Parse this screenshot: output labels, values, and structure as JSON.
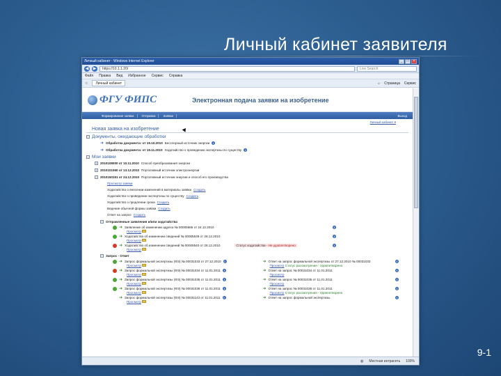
{
  "slide": {
    "title": "Личный кабинет заявителя",
    "page_number": "9-1"
  },
  "browser": {
    "window_title": "Личный кабинет - Windows Internet Explorer",
    "url": "https://10.1.1.20/",
    "search_placeholder": "Live Search",
    "menu": [
      "Файл",
      "Правка",
      "Вид",
      "Избранное",
      "Сервис",
      "Справка"
    ],
    "tab_label": "Личный кабинет",
    "toolbar_items": [
      "Страница",
      "Сервис"
    ],
    "status_text": "Местная интрасеть",
    "zoom": "100%"
  },
  "site": {
    "logo_text": "ФГУ ФИПС",
    "heading": "Электронная подача заявки на изобретение",
    "nav_tabs": [
      "Формирование заявки",
      "Отправка",
      "Заявки"
    ],
    "nav_right": "Выход",
    "user_select": "Личный кабинет"
  },
  "page": {
    "new_app_title": "Новая заявка на изобретение",
    "docs_section": "Документы, ожидающие обработки",
    "docs": [
      {
        "date": "Обработка документа: от 19.10.2010",
        "text": "Бесспорный источник энергии"
      },
      {
        "date": "Обработка документа: от 19.11.2010",
        "text": "Ходатайство о проведении экспертизы по существу"
      }
    ],
    "my_apps_section": "Мои заявки",
    "apps": [
      {
        "num": "2010108000 от 10.11.2010",
        "text": "Способ преобразования энергии"
      },
      {
        "num": "2010101060 от 13.12.2010",
        "text": "Портативный источник электроэнергии"
      },
      {
        "num": "2010150161 от 24.12.2010",
        "text": "Портативный источник энергии и способ его производства"
      }
    ],
    "app_actions": [
      {
        "text": "Просмотр заявки",
        "link": ""
      },
      {
        "text": "Ходатайство о внесении изменений в материалы заявки",
        "link": "Создать"
      },
      {
        "text": "Ходатайство о проведении экспертизы по существу",
        "link": "Создать"
      },
      {
        "text": "Ходатайство о продлении срока",
        "link": "Создать"
      },
      {
        "text": "Ведение обычной формы заявки",
        "link": "Создать"
      },
      {
        "text": "Ответ на запрос",
        "link": "Создать"
      }
    ],
    "sent_section": "Отправленные заявления и/или ходатайства",
    "sent": [
      {
        "status": "ok",
        "text": "Заявление об изменении адреса № 00005665 от 24.12.2010",
        "link": "Просмотр",
        "right": ""
      },
      {
        "status": "ok",
        "text": "Ходатайство об изменении сведений № 00005539 от 28.12.2010",
        "link": "Просмотр",
        "right": ""
      },
      {
        "status": "fail",
        "text": "Ходатайство об изменении сведений № 00005540 от 28.12.2010",
        "link": "Просмотр",
        "right_prefix": "Статус ходатайства -",
        "right": "Не удовлетворено"
      }
    ],
    "req_section": "Запрос - Ответ",
    "requests": [
      {
        "status": "ok",
        "left": "Запрос формальной экспертизы (ФЭ) № 00031033 от 27.12.2010",
        "left_link": "Просмотр",
        "right": "Ответ на запрос формальной экспертизы от 27.12.2010 № 00031033",
        "right_link": "Просмотр",
        "right_status": "Статус рассмотрения - Удовлетворено"
      },
      {
        "status": "fail",
        "left": "Запрос формальной экспертизы (ФЭ) № 00031034 от 11.01.2011",
        "left_link": "Просмотр",
        "right": "Ответ на запрос № 00031034 от 11.01.2011",
        "right_link": "Просмотр",
        "right_status": ""
      },
      {
        "status": "ok",
        "left": "Запрос формальной экспертизы (ФЭ) № 00031035 от 11.01.2011",
        "left_link": "Просмотр",
        "right": "Ответ на запрос № 00031035 от 11.01.2011",
        "right_link": "Просмотр",
        "right_status": ""
      },
      {
        "status": "ok",
        "left": "Запрос формальной экспертизы (ФЭ) № 00031036 от 11.01.2011",
        "left_link": "Просмотр",
        "right": "Ответ на запрос № 00031036 от 11.01.2011",
        "right_link": "Просмотр",
        "right_status": "Статус рассмотрения - Удовлетворено"
      },
      {
        "status": "new",
        "left": "Запрос формальной экспертизы (ФЭ) № 00031143 от 11.01.2011",
        "left_link": "Просмотр",
        "right": "Ответ на запрос формальной экспертизы",
        "right_link": "",
        "right_status": ""
      }
    ]
  }
}
